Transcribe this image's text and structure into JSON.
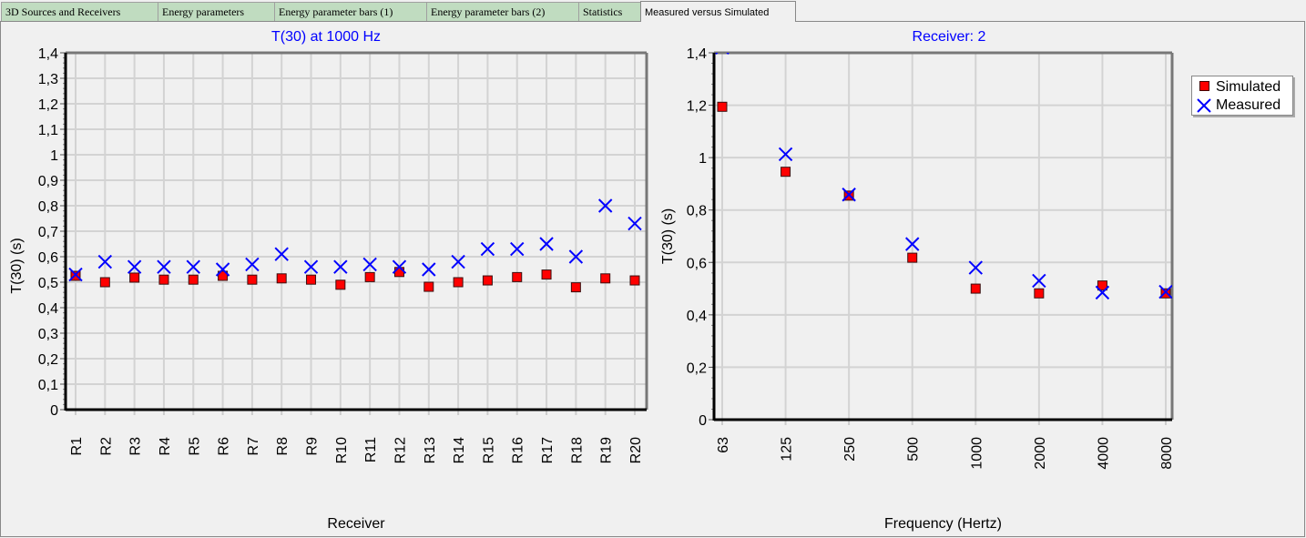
{
  "tabs": [
    {
      "label": "3D Sources and Receivers",
      "active": false
    },
    {
      "label": "Energy parameters",
      "active": false
    },
    {
      "label": "Energy parameter bars (1)",
      "active": false
    },
    {
      "label": "Energy parameter bars (2)",
      "active": false
    },
    {
      "label": "Statistics",
      "active": false
    },
    {
      "label": "Measured versus Simulated",
      "active": true
    }
  ],
  "colors": {
    "simulated": "#ff0000",
    "measured": "#0000ff",
    "title": "#0000ff",
    "grid": "#d3d3d3"
  },
  "legend": {
    "items": [
      {
        "label": "Simulated",
        "icon": "red-square-marker"
      },
      {
        "label": "Measured",
        "icon": "blue-x-marker"
      }
    ]
  },
  "chart_data": [
    {
      "type": "scatter",
      "title": "T(30) at 1000 Hz",
      "xlabel": "Receiver",
      "ylabel": "T(30) (s)",
      "ylim": [
        0,
        1.4
      ],
      "yticks": [
        "0",
        "0,1",
        "0,2",
        "0,3",
        "0,4",
        "0,5",
        "0,6",
        "0,7",
        "0,8",
        "0,9",
        "1",
        "1,1",
        "1,2",
        "1,3",
        "1,4"
      ],
      "grid": true,
      "categories": [
        "R1",
        "R2",
        "R3",
        "R4",
        "R5",
        "R6",
        "R7",
        "R8",
        "R9",
        "R10",
        "R11",
        "R12",
        "R13",
        "R14",
        "R15",
        "R16",
        "R17",
        "R18",
        "R19",
        "R20"
      ],
      "series": [
        {
          "name": "Simulated",
          "marker": "square",
          "values": [
            0.525,
            0.5,
            0.518,
            0.51,
            0.51,
            0.525,
            0.51,
            0.515,
            0.51,
            0.49,
            0.52,
            0.54,
            0.482,
            0.5,
            0.507,
            0.52,
            0.53,
            0.48,
            0.515,
            0.507
          ]
        },
        {
          "name": "Measured",
          "marker": "x",
          "values": [
            0.53,
            0.58,
            0.56,
            0.56,
            0.56,
            0.55,
            0.57,
            0.61,
            0.56,
            0.56,
            0.57,
            0.56,
            0.55,
            0.58,
            0.63,
            0.63,
            0.65,
            0.6,
            0.8,
            0.73
          ]
        }
      ]
    },
    {
      "type": "scatter",
      "title": "Receiver: 2",
      "xlabel": "Frequency (Hertz)",
      "ylabel": "T(30) (s)",
      "ylim": [
        0,
        1.4
      ],
      "yticks": [
        "0",
        "0,2",
        "0,4",
        "0,6",
        "0,8",
        "1",
        "1,2",
        "1,4"
      ],
      "grid": true,
      "legend_position": "right",
      "categories": [
        "63",
        "125",
        "250",
        "500",
        "1000",
        "2000",
        "4000",
        "8000"
      ],
      "series": [
        {
          "name": "Simulated",
          "marker": "square",
          "values": [
            1.194,
            0.946,
            0.855,
            0.618,
            0.5,
            0.482,
            0.512,
            0.482
          ]
        },
        {
          "name": "Measured",
          "marker": "x",
          "values": [
            1.42,
            1.013,
            0.859,
            0.67,
            0.58,
            0.53,
            0.485,
            0.488
          ]
        }
      ]
    }
  ]
}
